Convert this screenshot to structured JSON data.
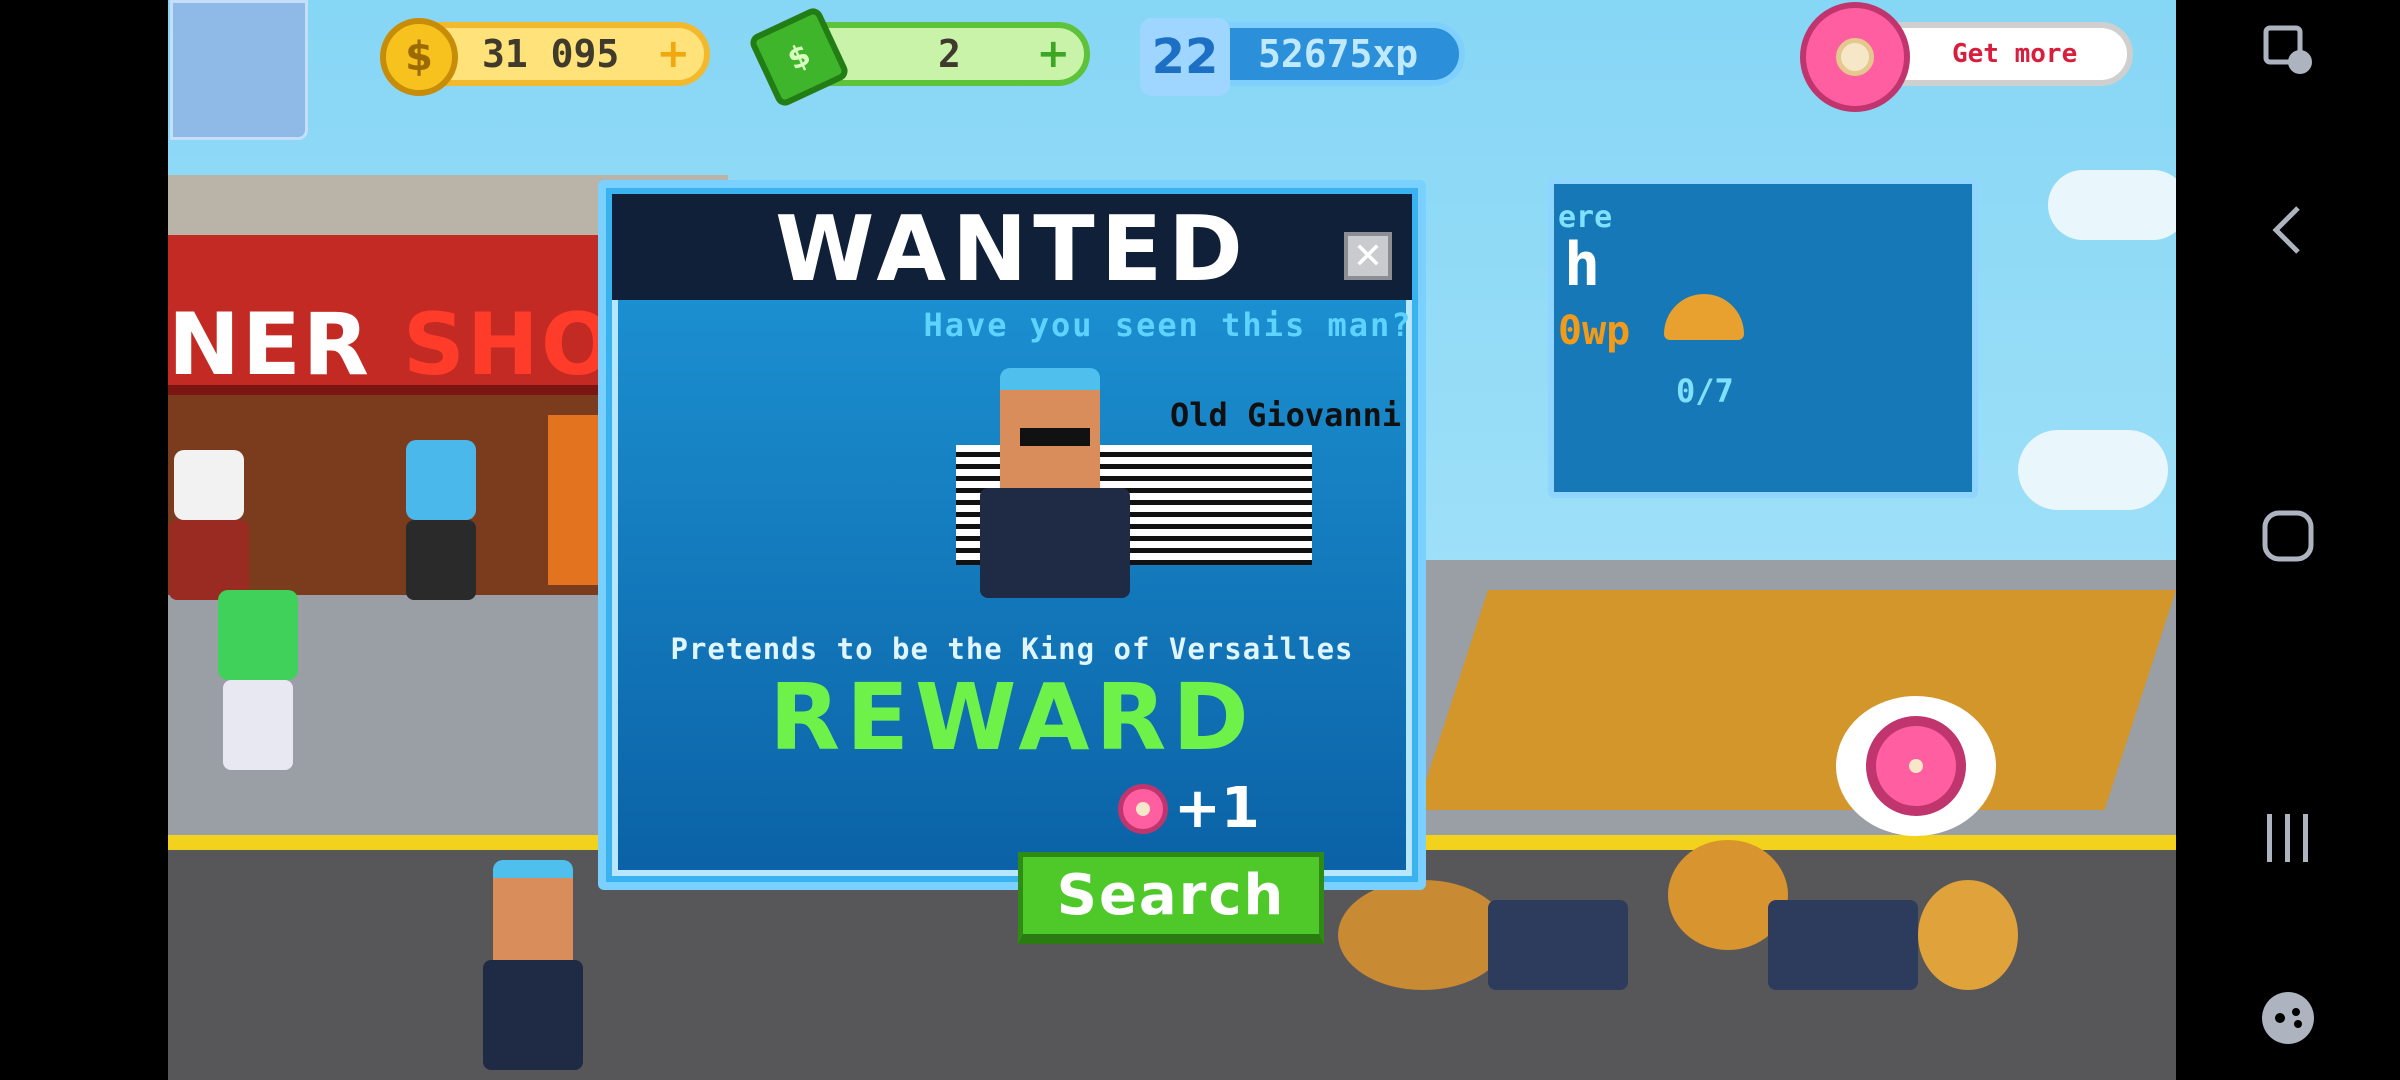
{
  "hud": {
    "coins": "31 095",
    "coins_plus": "+",
    "cash": "2",
    "cash_plus": "+",
    "level": "22",
    "xp": "52675xp",
    "get_more": "Get more"
  },
  "side_panel": {
    "partial_top": "ere",
    "partial_big": "h",
    "partial_orange": "0wp",
    "progress": "0/7"
  },
  "shop_sign": {
    "left": "NER",
    "right": "SHOP"
  },
  "modal": {
    "title": "WANTED",
    "close": "✕",
    "question": "Have you seen this man?",
    "suspect_name": "Old Giovanni",
    "description": "Pretends to be the King of Versailles",
    "reward_label": "REWARD",
    "reward_amount": "+1",
    "search_label": "Search"
  },
  "colors": {
    "sky": "#86d6f5",
    "modal_blue": "#0b62a6",
    "reward_green": "#6ef24a",
    "button_green": "#4fc92a",
    "donut_pink": "#ff5fa0"
  },
  "icons": {
    "coin": "coin-icon",
    "cash": "cash-icon",
    "xp": "star-level-icon",
    "donut": "donut-icon",
    "close": "close-icon",
    "nav": [
      "screenshot-tool-icon",
      "back-icon",
      "home-icon",
      "recents-icon",
      "game-controller-icon"
    ]
  }
}
